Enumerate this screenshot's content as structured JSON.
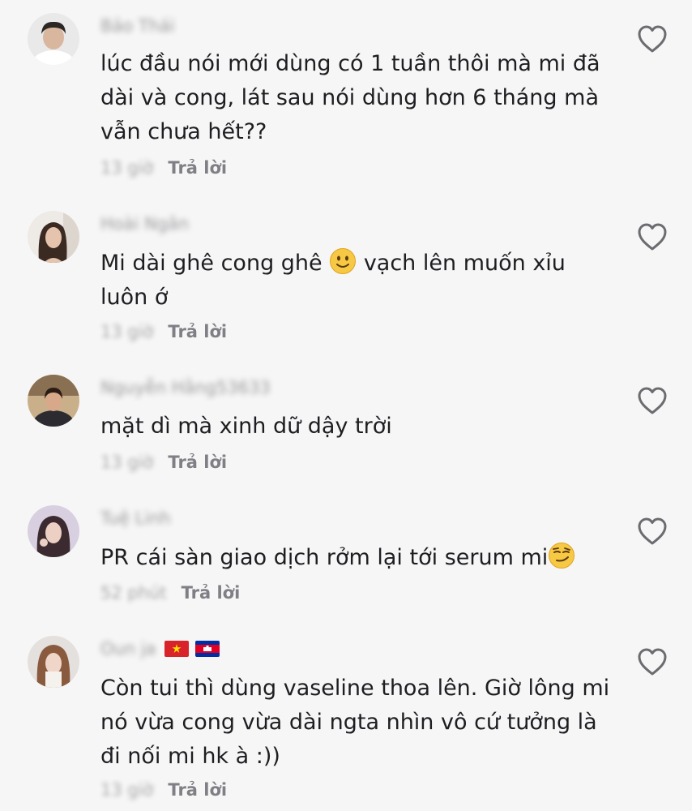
{
  "comments": [
    {
      "username": "Bảo Thái",
      "text": "lúc đầu nói mới dùng có 1 tuần thôi mà mi đã\ndài và cong, lát sau nói dùng hơn 6 tháng mà\nvẫn chưa hết??",
      "time": "13 giờ",
      "reply_label": "Trả lời"
    },
    {
      "username": "Hoài Ngân",
      "text_before_emoji": "Mi dài ghê cong ghê ",
      "emoji": "slightly-smiling-face-emoji",
      "text_after_emoji": " vạch lên muốn xỉu\nluôn ớ",
      "time": "13 giờ",
      "reply_label": "Trả lời"
    },
    {
      "username": "Nguyễn Hằng53633",
      "text": "mặt dì mà xinh dữ dậy trời",
      "time": "13 giờ",
      "reply_label": "Trả lời"
    },
    {
      "username": "Tuệ Linh",
      "text_before_emoji": "PR cái sàn giao dịch rởm lại tới serum mi",
      "emoji": "smirking-face-emoji",
      "time": "52 phút",
      "reply_label": "Trả lời"
    },
    {
      "username": "Oun ja",
      "flags": [
        "vietnam-flag-icon",
        "cambodia-flag-icon"
      ],
      "text": "Còn tui thì dùng vaseline thoa lên. Giờ lông mi\nnó vừa cong vừa dài ngta nhìn vô cứ tưởng là\nđi nối mi hk à :))",
      "time": "13 giờ",
      "reply_label": "Trả lời"
    }
  ],
  "colors": {
    "background": "#f6f6f6",
    "text": "#1e1e22",
    "muted": "#9a9a9e",
    "reply": "#7f7f85",
    "heart_stroke": "#6b6b70"
  },
  "icons": {
    "like": "heart-outline-icon"
  }
}
